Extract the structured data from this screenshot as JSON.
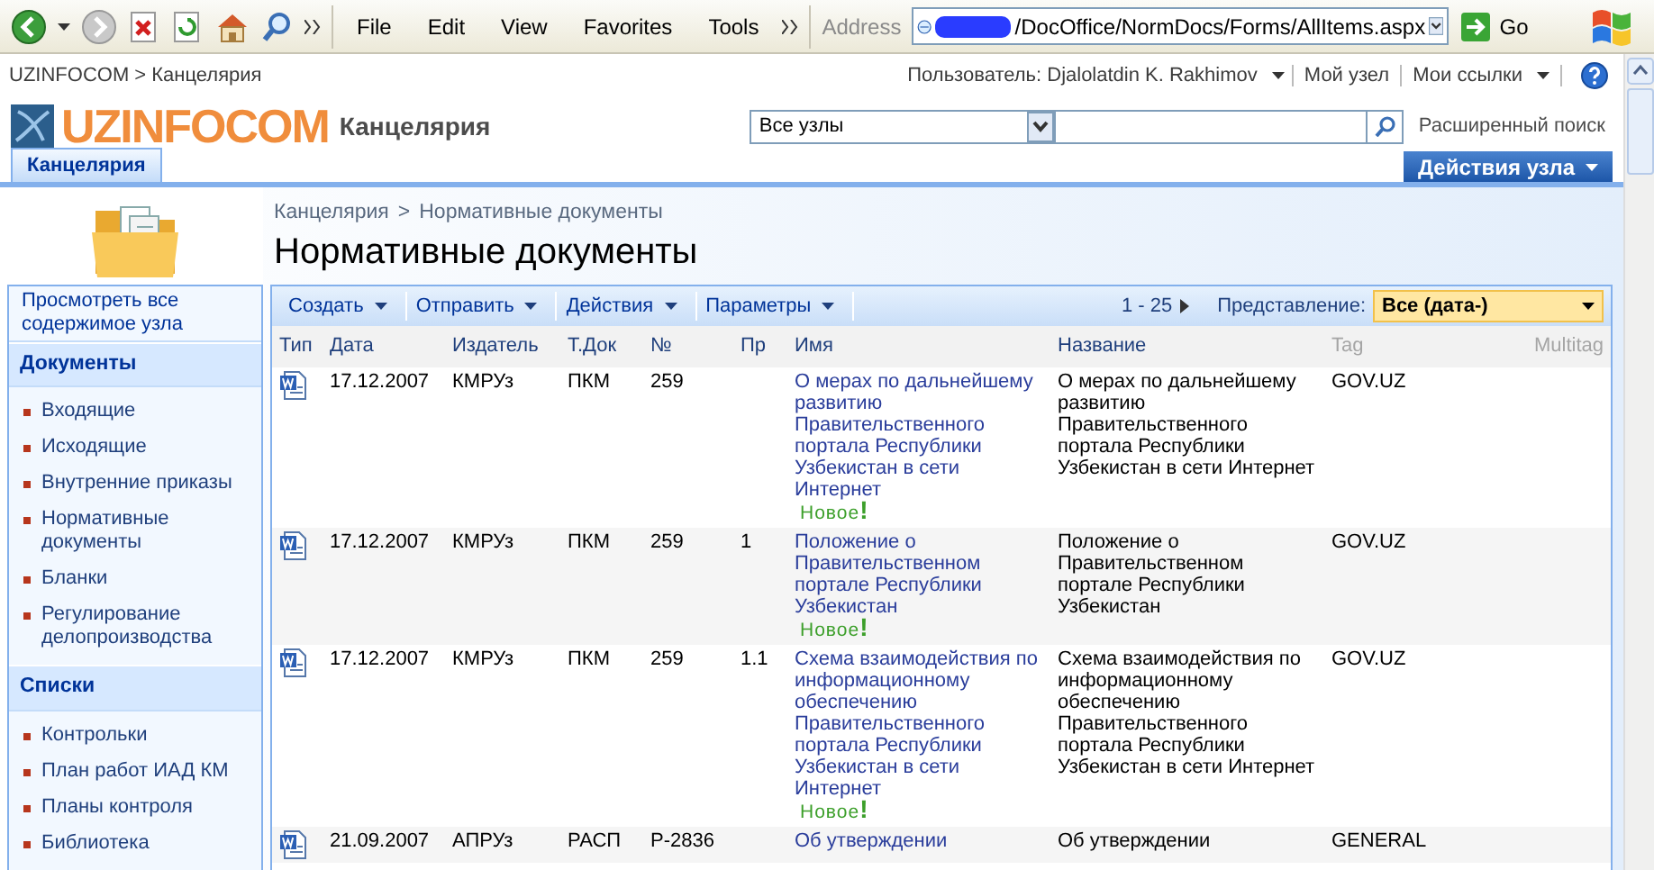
{
  "browser": {
    "menu": [
      "File",
      "Edit",
      "View",
      "Favorites",
      "Tools"
    ],
    "address_label": "Address",
    "address": "/DocOffice/NormDocs/Forms/AllItems.aspx",
    "go_label": "Go"
  },
  "top_bar": {
    "breadcrumb": "UZINFOCOM > Канцелярия",
    "user": "Пользователь: Djalolatdin K. Rakhimov",
    "links": [
      "Мой узел",
      "Мои ссылки"
    ]
  },
  "header": {
    "logo_text": "UZINFOCOM",
    "site_title": "Канцелярия",
    "search_scope": "Все узлы",
    "advanced_search": "Расширенный поиск"
  },
  "tabs": [
    {
      "label": "Канцелярия",
      "selected": true
    }
  ],
  "site_actions": "Действия узла",
  "page": {
    "breadcrumb": [
      "Канцелярия",
      "Нормативные документы"
    ],
    "separator": ">",
    "title": "Нормативные документы"
  },
  "sidebar": {
    "view_all": "Просмотреть все содержимое узла",
    "sections": [
      {
        "title": "Документы",
        "items": [
          "Входящие",
          "Исходящие",
          "Внутренние приказы",
          "Нормативные документы",
          "Бланки",
          "Регулирование делопроизводства"
        ]
      },
      {
        "title": "Списки",
        "items": [
          "Контрольки",
          "План работ ИАД КМ",
          "Планы контроля",
          "Библиотека"
        ]
      }
    ]
  },
  "toolbar": {
    "menus": [
      "Создать",
      "Отправить",
      "Действия",
      "Параметры"
    ],
    "paging": "1 - 25",
    "view_label": "Представление:",
    "view": "Все (дата-)"
  },
  "table": {
    "columns": [
      {
        "label": "Тип",
        "sortable": true
      },
      {
        "label": "Дата",
        "sortable": true
      },
      {
        "label": "Издатель",
        "sortable": true
      },
      {
        "label": "Т.Док",
        "sortable": true
      },
      {
        "label": "№",
        "sortable": true
      },
      {
        "label": "Пр",
        "sortable": true
      },
      {
        "label": "Имя",
        "sortable": true
      },
      {
        "label": "Название",
        "sortable": true
      },
      {
        "label": "Tag",
        "sortable": false
      },
      {
        "label": "Multitag",
        "sortable": false
      }
    ],
    "rows": [
      {
        "date": "17.12.2007",
        "publisher": "КМРУз",
        "doc_type": "ПКМ",
        "number": "259",
        "item": "",
        "name": "О мерах по дальнейшему развитию Правительственного портала Республики Узбекистан в сети Интернет",
        "new_label": "Новое",
        "new_mark": "!",
        "title": "О мерах по дальнейшему развитию Правительственного портала Республики Узбекистан в сети Интернет",
        "tag": "GOV.UZ"
      },
      {
        "date": "17.12.2007",
        "publisher": "КМРУз",
        "doc_type": "ПКМ",
        "number": "259",
        "item": "1",
        "name": "Положение о Правительственном портале Республики Узбекистан",
        "new_label": "Новое",
        "new_mark": "!",
        "title": "Положение о Правительственном портале Республики Узбекистан",
        "tag": "GOV.UZ"
      },
      {
        "date": "17.12.2007",
        "publisher": "КМРУз",
        "doc_type": "ПКМ",
        "number": "259",
        "item": "1.1",
        "name": "Схема взаимодействия по информационному обеспечению Правительственного портала Республики Узбекистан в сети Интернет",
        "new_label": "Новое",
        "new_mark": "!",
        "title": "Схема взаимодействия по информационному обеспечению Правительственного портала Республики Узбекистан в сети Интернет",
        "tag": "GOV.UZ"
      },
      {
        "date": "21.09.2007",
        "publisher": "АПРУз",
        "doc_type": "РАСП",
        "number": "Р-2836",
        "item": "",
        "name": "Об утверждении",
        "title": "Об утверждении",
        "tag": "GENERAL"
      }
    ]
  }
}
